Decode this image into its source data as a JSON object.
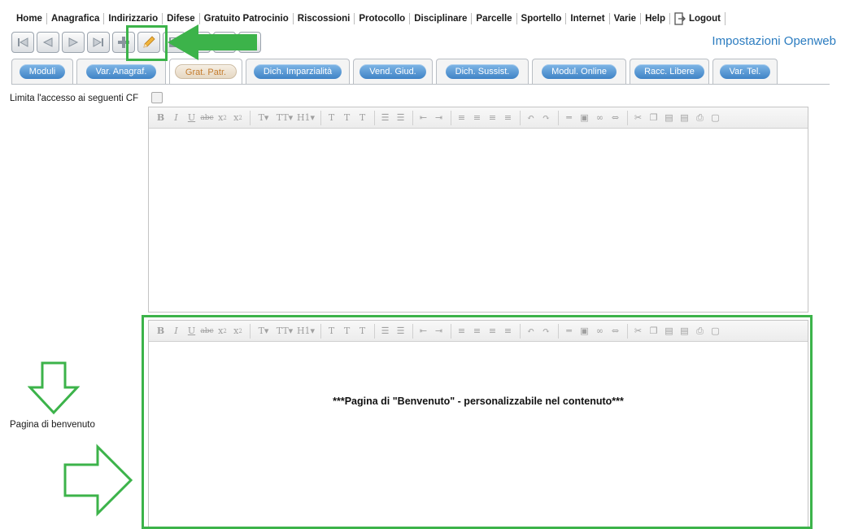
{
  "menu": {
    "items": [
      "Home",
      "Anagrafica",
      "Indirizzario",
      "Difese",
      "Gratuito Patrocinio",
      "Riscossioni",
      "Protocollo",
      "Disciplinare",
      "Parcelle",
      "Sportello",
      "Internet",
      "Varie",
      "Help"
    ],
    "logout_label": "Logout"
  },
  "toolbar": {
    "buttons": [
      "first-icon",
      "previous-icon",
      "next-icon",
      "last-icon",
      "add-icon",
      "edit-icon",
      "save-icon",
      "delete-icon",
      "download-icon"
    ]
  },
  "settings_link": "Impostazioni Openweb",
  "tabs": [
    "Moduli",
    "Var. Anagraf.",
    "Grat. Patr.",
    "Dich. Imparzialità",
    "Vend. Giud.",
    "Dich. Sussist.",
    "Modul. Online",
    "Racc. Libere",
    "Var. Tel."
  ],
  "active_tab": "Grat. Patr.",
  "form": {
    "cf_label": "Limita l'accesso ai seguenti CF",
    "welcome_label": "Pagina di benvenuto"
  },
  "editor": {
    "welcome_content": "***Pagina di \"Benvenuto\" - personalizzabile nel contenuto***"
  },
  "colors": {
    "accent": "#2b7cc0",
    "tab_pill": "#4a8fd0",
    "active_tab_text": "#c47c2e",
    "annotation_green": "#3cb34a"
  }
}
